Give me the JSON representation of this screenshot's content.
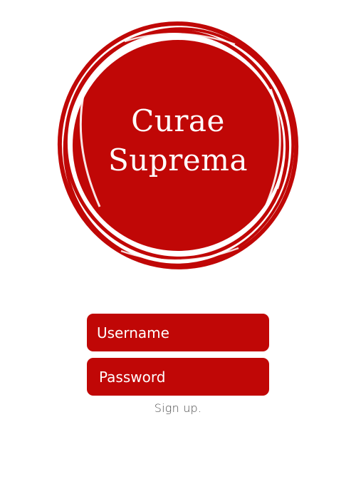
{
  "logo": {
    "line1": "Curae",
    "line2": "Suprema",
    "color": "#c00706"
  },
  "form": {
    "username_label": "Username",
    "password_label": "Password",
    "signup_link": "Sign up."
  }
}
